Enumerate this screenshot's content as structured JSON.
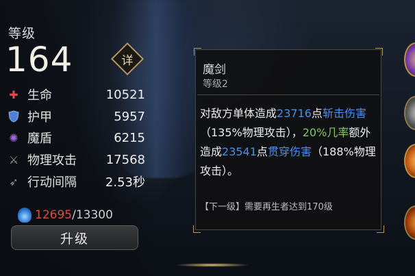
{
  "stats_panel": {
    "level_label": "等级",
    "level_value": "164",
    "detail_button_label": "详",
    "stats": [
      {
        "icon": "health-cross-icon",
        "name": "生命",
        "value": "10521",
        "color": "#e04a4a"
      },
      {
        "icon": "armor-shield-icon",
        "name": "护甲",
        "value": "5957",
        "color": "#5a8de0"
      },
      {
        "icon": "magic-shield-swirl-icon",
        "name": "魔盾",
        "value": "6215",
        "color": "#9a6ae0"
      },
      {
        "icon": "sword-attack-icon",
        "name": "物理攻击",
        "value": "17568",
        "color": "#9a9a9a"
      },
      {
        "icon": "wing-speed-icon",
        "name": "行动间隔",
        "value": "2.53秒",
        "color": "#9a9a9a"
      }
    ],
    "energy": {
      "icon": "blue-flame-icon",
      "current": "12695",
      "separator": "/",
      "max": "13300"
    },
    "upgrade_button_label": "升级"
  },
  "skill_tooltip": {
    "name": "魔剑",
    "level": "等级2",
    "description": {
      "p1": "对敌方单体造成",
      "v1": "23716",
      "p2": "点",
      "k1": "斩击伤害",
      "p3": "（135%物理攻击），",
      "v2": "20%几率",
      "p4": "额外造成",
      "v3": "23541",
      "p5": "点",
      "k2": "贯穿伤害",
      "p6": "（188%物理攻击）。"
    },
    "next_level": "【下一级】需要再生者达到170级"
  },
  "colors": {
    "highlight_blue": "#4d8fe8",
    "highlight_green": "#7fc85a",
    "energy_red": "#e04a3f",
    "gold_border": "#b59a64"
  },
  "right_edge_icons": [
    "purple-orb-icon",
    "gray-orb-icon",
    "orange-orb-icon",
    "orange-fire-orb-icon"
  ]
}
